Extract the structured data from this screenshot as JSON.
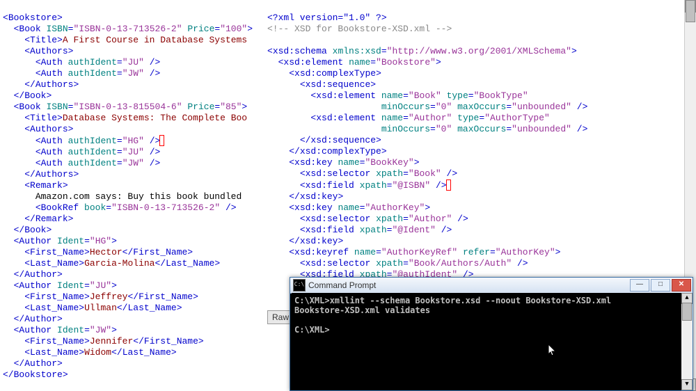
{
  "left_xml": {
    "root_open": "Bookstore",
    "books": [
      {
        "isbn": "ISBN-0-13-713526-2",
        "price": "100",
        "title": "A First Course in Database Systems",
        "authors": [
          {
            "ident": "JU"
          },
          {
            "ident": "JW"
          }
        ],
        "remark": null
      },
      {
        "isbn": "ISBN-0-13-815504-6",
        "price": "85",
        "title": "Database Systems: The Complete Boo",
        "authors": [
          {
            "ident": "HG",
            "cursor": true
          },
          {
            "ident": "JU"
          },
          {
            "ident": "JW"
          }
        ],
        "remark": {
          "text": "Amazon.com says: Buy this book bundled",
          "bookref": "ISBN-0-13-713526-2"
        }
      }
    ],
    "authors": [
      {
        "ident": "HG",
        "first": "Hector",
        "last": "Garcia-Molina"
      },
      {
        "ident": "JU",
        "first": "Jeffrey",
        "last": "Ullman"
      },
      {
        "ident": "JW",
        "first": "Jennifer",
        "last": "Widom"
      }
    ],
    "root_close": "Bookstore"
  },
  "right_xml": {
    "decl": "<?xml version=\"1.0\" ?>",
    "comment": "<!-- XSD for Bookstore-XSD.xml -->",
    "schema_xmlns": "http://www.w3.org/2001/XMLSchema",
    "root_element_name": "Bookstore",
    "seq_elements": [
      {
        "name": "Book",
        "type": "BookType",
        "min": "0",
        "max": "unbounded"
      },
      {
        "name": "Author",
        "type": "AuthorType",
        "min": "0",
        "max": "unbounded"
      }
    ],
    "keys": [
      {
        "name": "BookKey",
        "selector": "Book",
        "field": "@ISBN",
        "cursor": true
      },
      {
        "name": "AuthorKey",
        "selector": "Author",
        "field": "@Ident"
      }
    ],
    "keyref": {
      "name": "AuthorKeyRef",
      "refer": "AuthorKey",
      "selector": "Book/Authors/Auth",
      "field": "@authIdent"
    }
  },
  "raw_button": "Raw",
  "cmd": {
    "title": "Command Prompt",
    "lines": [
      "C:\\XML>xmllint --schema Bookstore.xsd --noout Bookstore-XSD.xml",
      "Bookstore-XSD.xml validates",
      "",
      "C:\\XML>"
    ]
  }
}
